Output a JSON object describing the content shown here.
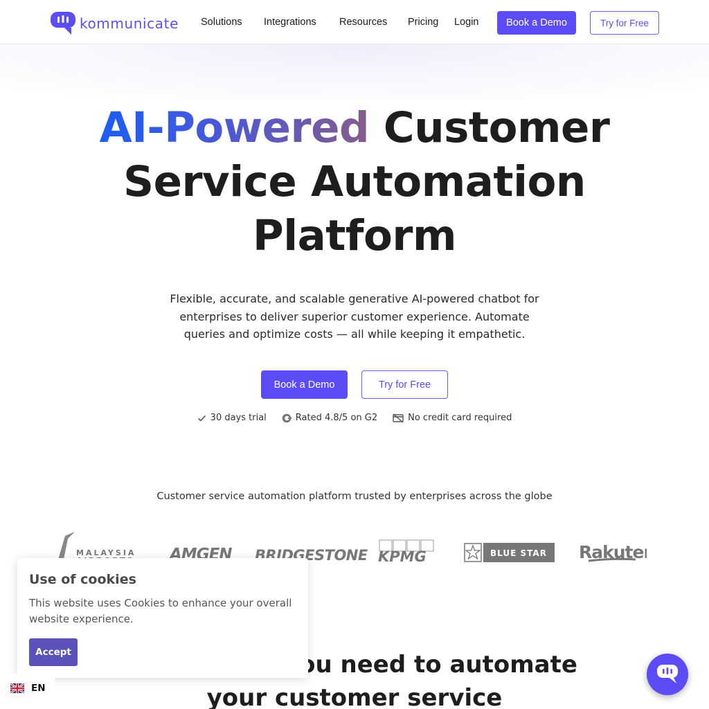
{
  "colors": {
    "brand": "#5b4cf5",
    "headline_gradient": [
      "#1a5ef6",
      "#4a58d8",
      "#865c8a"
    ],
    "cookie_accent": "#5a52b8"
  },
  "nav": {
    "logo_text": "kommunicate",
    "items": [
      "Solutions",
      "Integrations",
      "Resources",
      "Pricing",
      "Login"
    ],
    "book_demo": "Book a Demo",
    "try_free": "Try for Free"
  },
  "hero": {
    "headline_gradient_part": "AI-Powered",
    "headline_line1_rest": "Customer",
    "headline_line2": "Service Automation",
    "headline_line3": "Platform",
    "subtitle": "Flexible, accurate, and scalable generative AI-powered chatbot for enterprises to deliver superior customer experience. Automate queries and optimize costs — all while keeping it empathetic.",
    "book_demo": "Book a Demo",
    "try_free": "Try for Free",
    "perks": [
      {
        "icon": "check-icon",
        "text": "30 days trial"
      },
      {
        "icon": "g2-icon",
        "text": "Rated 4.8/5 on G2"
      },
      {
        "icon": "no-credit-card-icon",
        "text": "No credit card required"
      }
    ]
  },
  "trusted": {
    "text": "Customer service automation platform trusted by enterprises across the globe",
    "logos": [
      "Malaysia Airports",
      "AMGEN",
      "Bridgestone",
      "KPMG",
      "BLUE STAR",
      "Rakuten"
    ]
  },
  "section": {
    "heading_line1": "Everything you need to automate",
    "heading_line2": "your customer service"
  },
  "cookie": {
    "title": "Use of cookies",
    "text": "This website uses Cookies to enhance your overall website experience.",
    "accept": "Accept"
  },
  "language": {
    "code": "EN"
  }
}
